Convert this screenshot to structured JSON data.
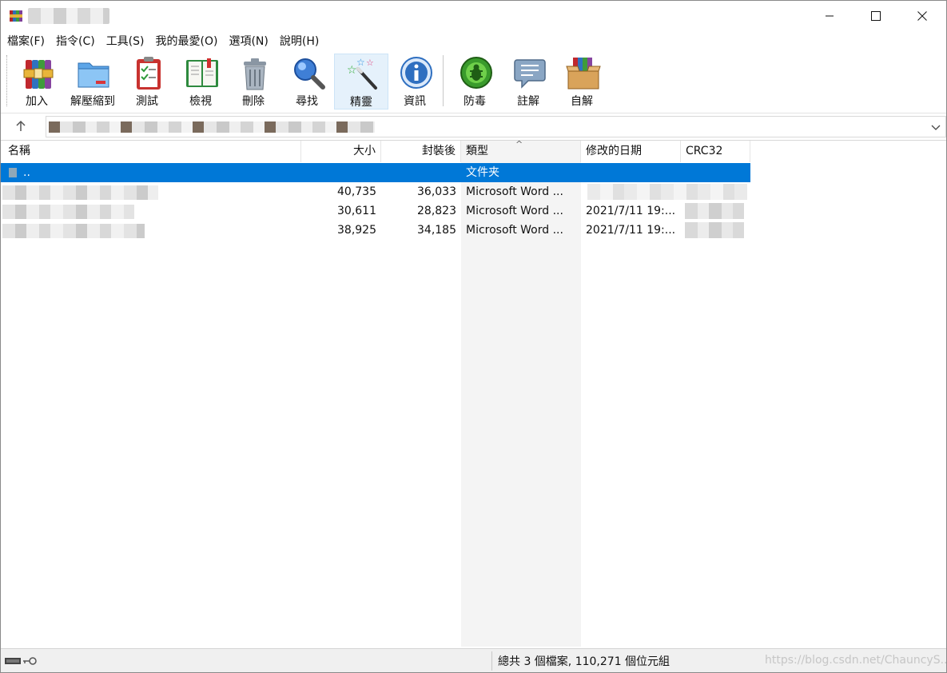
{
  "window": {
    "title": "██████",
    "accent": "#0078d7"
  },
  "menu": [
    {
      "label": "檔案(F)"
    },
    {
      "label": "指令(C)"
    },
    {
      "label": "工具(S)"
    },
    {
      "label": "我的最愛(O)"
    },
    {
      "label": "選項(N)"
    },
    {
      "label": "說明(H)"
    }
  ],
  "toolbar": [
    {
      "label": "加入",
      "icon": "add-archive-icon"
    },
    {
      "label": "解壓縮到",
      "icon": "extract-folder-icon"
    },
    {
      "label": "測試",
      "icon": "test-clipboard-icon"
    },
    {
      "label": "檢視",
      "icon": "view-book-icon"
    },
    {
      "label": "刪除",
      "icon": "trash-icon"
    },
    {
      "label": "尋找",
      "icon": "magnifier-icon"
    },
    {
      "label": "精靈",
      "icon": "wizard-wand-icon"
    },
    {
      "label": "資訊",
      "icon": "info-icon"
    },
    {
      "label": "防毒",
      "icon": "antivirus-bug-icon"
    },
    {
      "label": "註解",
      "icon": "comment-icon"
    },
    {
      "label": "自解",
      "icon": "sfx-box-icon"
    }
  ],
  "address": {
    "path": "████████████████████"
  },
  "columns": {
    "name": "名稱",
    "size": "大小",
    "packed": "封裝後",
    "type": "類型",
    "modified": "修改的日期",
    "crc": "CRC32"
  },
  "rows": [
    {
      "name": "..",
      "size": "",
      "packed": "",
      "type": "文件夹",
      "modified": "",
      "crc": "",
      "selected": true
    },
    {
      "name": "",
      "size": "40,735",
      "packed": "36,033",
      "type": "Microsoft Word ...",
      "modified": "",
      "crc": "",
      "selected": false
    },
    {
      "name": "",
      "size": "30,611",
      "packed": "28,823",
      "type": "Microsoft Word ...",
      "modified": "2021/7/11 19:...",
      "crc": "",
      "selected": false
    },
    {
      "name": "",
      "size": "38,925",
      "packed": "34,185",
      "type": "Microsoft Word ...",
      "modified": "2021/7/11 19:...",
      "crc": "",
      "selected": false
    }
  ],
  "status": {
    "summary": "總共 3 個檔案, 110,271 個位元組",
    "watermark": "https://blog.csdn.net/ChauncyS..."
  }
}
